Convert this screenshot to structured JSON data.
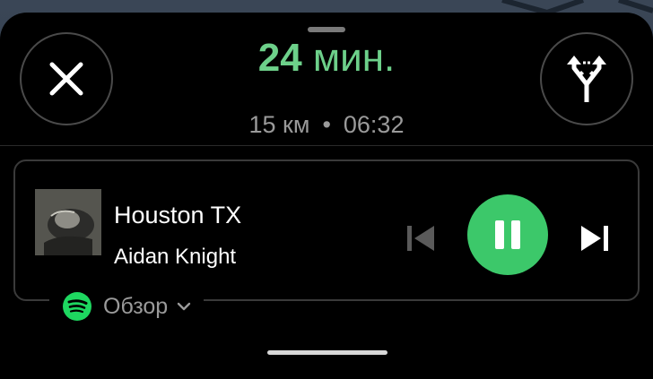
{
  "eta": {
    "minutes": "24",
    "unit": "мин.",
    "distance": "15 км",
    "separator": "•",
    "arrival_time": "06:32"
  },
  "media": {
    "track_title": "Houston TX",
    "artist": "Aidan Knight",
    "source_label": "Обзор",
    "state": "playing"
  },
  "icons": {
    "close": "close-icon",
    "route_options": "alternate-routes-icon",
    "previous": "skip-previous-icon",
    "pause": "pause-icon",
    "next": "skip-next-icon",
    "source": "spotify-icon",
    "chevron": "chevron-down-icon"
  },
  "colors": {
    "eta_green": "#6dd08a",
    "play_button": "#3cc86a",
    "spotify_green": "#1ed760",
    "sheet_background": "#000000"
  }
}
